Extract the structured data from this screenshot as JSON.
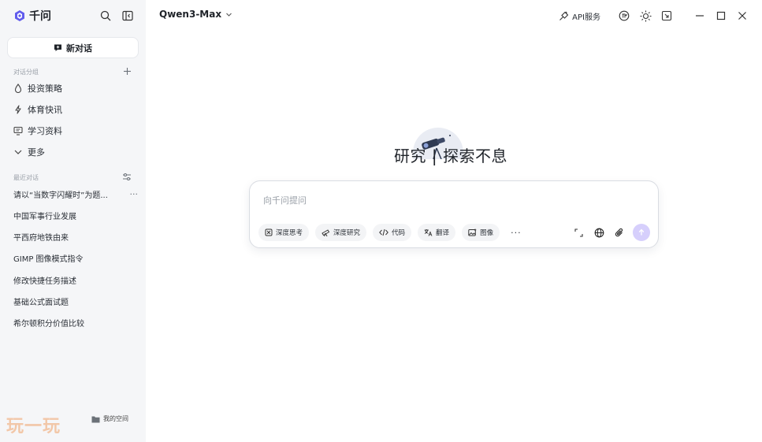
{
  "app": {
    "logo_text": "千问"
  },
  "sidebar": {
    "new_chat_label": "新对话",
    "groups_header": "对话分组",
    "groups": [
      {
        "label": "投资策略",
        "icon": "drop-icon"
      },
      {
        "label": "体育快讯",
        "icon": "lightning-icon"
      },
      {
        "label": "学习资料",
        "icon": "monitor-icon"
      },
      {
        "label": "更多",
        "icon": "chevron-down-icon"
      }
    ],
    "recent_header": "最近对话",
    "recent": [
      "请以“当数字闪耀时”为题...",
      "中国军事行业发展",
      "平西府地铁由来",
      "GIMP 图像模式指令",
      "修改快捷任务描述",
      "基础公式面试题",
      "希尔顿积分价值比较"
    ],
    "my_space_label": "我的空间",
    "watermark": "玩一玩"
  },
  "header": {
    "model_name": "Qwen3-Max",
    "api_label": "API服务"
  },
  "hero": {
    "text": "研究 | 探索不息"
  },
  "composer": {
    "placeholder": "向千问提问",
    "chips": [
      "深度思考",
      "深度研究",
      "代码",
      "翻译",
      "图像"
    ],
    "more_label": "···"
  },
  "colors": {
    "brand": "#615ced",
    "sidebar_bg": "#f5f6f8",
    "send_button": "#d6cffc"
  }
}
